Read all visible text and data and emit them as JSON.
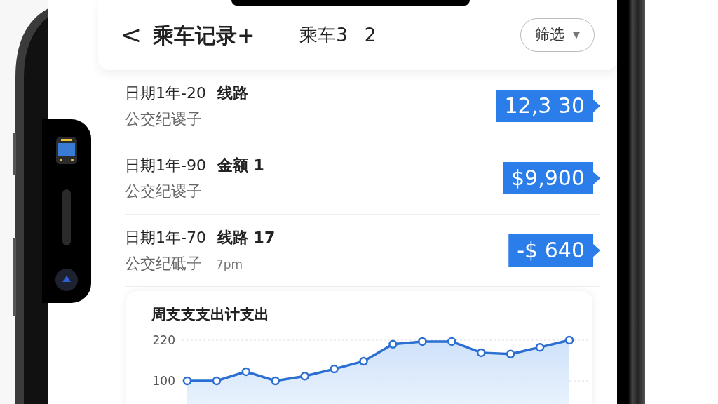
{
  "header": {
    "back": "<",
    "title": "乘车记录+",
    "count_label": "乘车3",
    "count": "2",
    "filter": {
      "label": "筛选",
      "caret": "▼"
    }
  },
  "records": [
    {
      "date": "日期1年-20",
      "detail": "线路",
      "subtitle": "公交纪谡子",
      "amount": "12,3 30"
    },
    {
      "date": "日期1年-90",
      "detail": "金额 1",
      "subtitle": "公交纪谡子",
      "amount": "$9,900"
    },
    {
      "date": "日期1年-70",
      "detail": "线路 17",
      "subtitle": "公交纪砥子",
      "time": "7pm",
      "amount": "-$ 640"
    }
  ],
  "chart": {
    "title": "周支支支出计支出",
    "chart_data": {
      "type": "area",
      "values": [
        100,
        100,
        127,
        100,
        114,
        135,
        158,
        208,
        216,
        216,
        183,
        179,
        199,
        220
      ],
      "ylim": [
        100,
        220
      ],
      "yticks": [
        100,
        220
      ]
    }
  }
}
